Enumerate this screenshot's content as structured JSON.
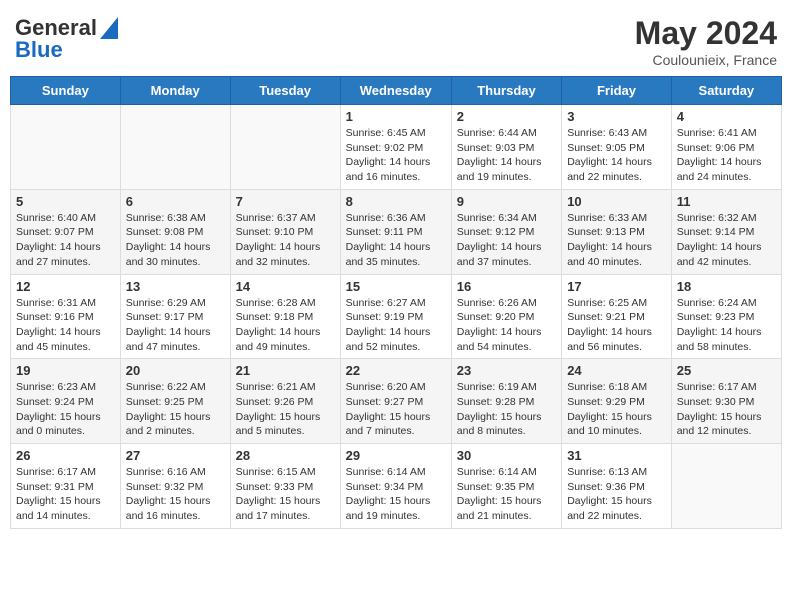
{
  "header": {
    "logo_general": "General",
    "logo_blue": "Blue",
    "month_year": "May 2024",
    "location": "Coulounieix, France"
  },
  "days_of_week": [
    "Sunday",
    "Monday",
    "Tuesday",
    "Wednesday",
    "Thursday",
    "Friday",
    "Saturday"
  ],
  "weeks": [
    [
      {
        "day": "",
        "info": ""
      },
      {
        "day": "",
        "info": ""
      },
      {
        "day": "",
        "info": ""
      },
      {
        "day": "1",
        "info": "Sunrise: 6:45 AM\nSunset: 9:02 PM\nDaylight: 14 hours and 16 minutes."
      },
      {
        "day": "2",
        "info": "Sunrise: 6:44 AM\nSunset: 9:03 PM\nDaylight: 14 hours and 19 minutes."
      },
      {
        "day": "3",
        "info": "Sunrise: 6:43 AM\nSunset: 9:05 PM\nDaylight: 14 hours and 22 minutes."
      },
      {
        "day": "4",
        "info": "Sunrise: 6:41 AM\nSunset: 9:06 PM\nDaylight: 14 hours and 24 minutes."
      }
    ],
    [
      {
        "day": "5",
        "info": "Sunrise: 6:40 AM\nSunset: 9:07 PM\nDaylight: 14 hours and 27 minutes."
      },
      {
        "day": "6",
        "info": "Sunrise: 6:38 AM\nSunset: 9:08 PM\nDaylight: 14 hours and 30 minutes."
      },
      {
        "day": "7",
        "info": "Sunrise: 6:37 AM\nSunset: 9:10 PM\nDaylight: 14 hours and 32 minutes."
      },
      {
        "day": "8",
        "info": "Sunrise: 6:36 AM\nSunset: 9:11 PM\nDaylight: 14 hours and 35 minutes."
      },
      {
        "day": "9",
        "info": "Sunrise: 6:34 AM\nSunset: 9:12 PM\nDaylight: 14 hours and 37 minutes."
      },
      {
        "day": "10",
        "info": "Sunrise: 6:33 AM\nSunset: 9:13 PM\nDaylight: 14 hours and 40 minutes."
      },
      {
        "day": "11",
        "info": "Sunrise: 6:32 AM\nSunset: 9:14 PM\nDaylight: 14 hours and 42 minutes."
      }
    ],
    [
      {
        "day": "12",
        "info": "Sunrise: 6:31 AM\nSunset: 9:16 PM\nDaylight: 14 hours and 45 minutes."
      },
      {
        "day": "13",
        "info": "Sunrise: 6:29 AM\nSunset: 9:17 PM\nDaylight: 14 hours and 47 minutes."
      },
      {
        "day": "14",
        "info": "Sunrise: 6:28 AM\nSunset: 9:18 PM\nDaylight: 14 hours and 49 minutes."
      },
      {
        "day": "15",
        "info": "Sunrise: 6:27 AM\nSunset: 9:19 PM\nDaylight: 14 hours and 52 minutes."
      },
      {
        "day": "16",
        "info": "Sunrise: 6:26 AM\nSunset: 9:20 PM\nDaylight: 14 hours and 54 minutes."
      },
      {
        "day": "17",
        "info": "Sunrise: 6:25 AM\nSunset: 9:21 PM\nDaylight: 14 hours and 56 minutes."
      },
      {
        "day": "18",
        "info": "Sunrise: 6:24 AM\nSunset: 9:23 PM\nDaylight: 14 hours and 58 minutes."
      }
    ],
    [
      {
        "day": "19",
        "info": "Sunrise: 6:23 AM\nSunset: 9:24 PM\nDaylight: 15 hours and 0 minutes."
      },
      {
        "day": "20",
        "info": "Sunrise: 6:22 AM\nSunset: 9:25 PM\nDaylight: 15 hours and 2 minutes."
      },
      {
        "day": "21",
        "info": "Sunrise: 6:21 AM\nSunset: 9:26 PM\nDaylight: 15 hours and 5 minutes."
      },
      {
        "day": "22",
        "info": "Sunrise: 6:20 AM\nSunset: 9:27 PM\nDaylight: 15 hours and 7 minutes."
      },
      {
        "day": "23",
        "info": "Sunrise: 6:19 AM\nSunset: 9:28 PM\nDaylight: 15 hours and 8 minutes."
      },
      {
        "day": "24",
        "info": "Sunrise: 6:18 AM\nSunset: 9:29 PM\nDaylight: 15 hours and 10 minutes."
      },
      {
        "day": "25",
        "info": "Sunrise: 6:17 AM\nSunset: 9:30 PM\nDaylight: 15 hours and 12 minutes."
      }
    ],
    [
      {
        "day": "26",
        "info": "Sunrise: 6:17 AM\nSunset: 9:31 PM\nDaylight: 15 hours and 14 minutes."
      },
      {
        "day": "27",
        "info": "Sunrise: 6:16 AM\nSunset: 9:32 PM\nDaylight: 15 hours and 16 minutes."
      },
      {
        "day": "28",
        "info": "Sunrise: 6:15 AM\nSunset: 9:33 PM\nDaylight: 15 hours and 17 minutes."
      },
      {
        "day": "29",
        "info": "Sunrise: 6:14 AM\nSunset: 9:34 PM\nDaylight: 15 hours and 19 minutes."
      },
      {
        "day": "30",
        "info": "Sunrise: 6:14 AM\nSunset: 9:35 PM\nDaylight: 15 hours and 21 minutes."
      },
      {
        "day": "31",
        "info": "Sunrise: 6:13 AM\nSunset: 9:36 PM\nDaylight: 15 hours and 22 minutes."
      },
      {
        "day": "",
        "info": ""
      }
    ]
  ]
}
